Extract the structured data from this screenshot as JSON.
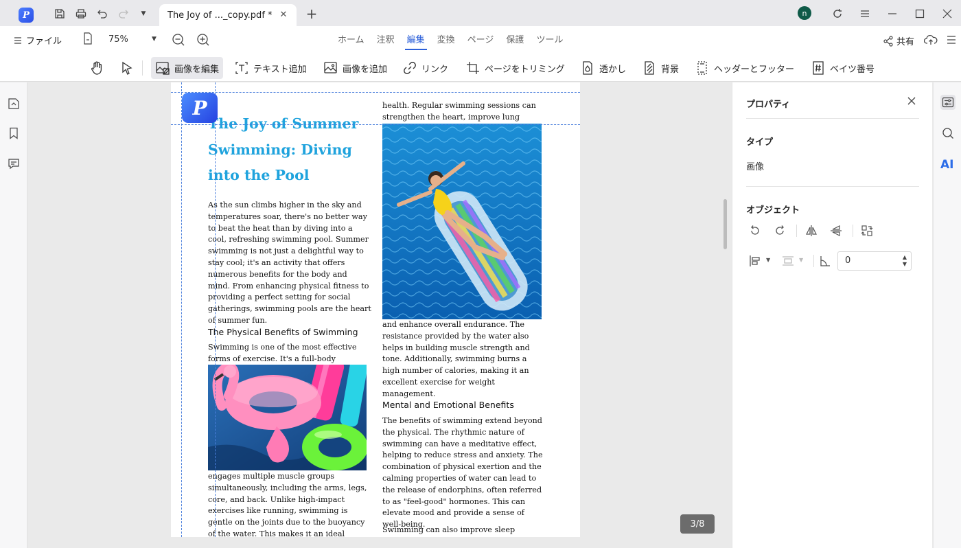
{
  "titlebar": {
    "tab_title": "The Joy of ..._copy.pdf *",
    "avatar_initial": "n"
  },
  "menubar": {
    "file_label": "ファイル",
    "zoom": "75%",
    "tabs": [
      "ホーム",
      "注釈",
      "編集",
      "変換",
      "ページ",
      "保護",
      "ツール"
    ],
    "active_tab": "編集",
    "share_label": "共有"
  },
  "toolbar": {
    "edit_image": "画像を編集",
    "add_text": "テキスト追加",
    "add_image": "画像を追加",
    "link": "リンク",
    "crop_page": "ページをトリミング",
    "watermark": "透かし",
    "background": "背景",
    "header_footer": "ヘッダーとフッター",
    "bates": "ベイツ番号"
  },
  "document": {
    "title": "The Joy of Summer Swimming: Diving into the Pool",
    "intro": "As the sun climbs higher in the sky and temperatures soar, there's no better way to beat the heat than by diving into a cool, refreshing swimming pool. Summer swimming is not just a delightful way to stay cool; it's an activity that offers numerous benefits for the body and mind. From enhancing physical fitness to providing a perfect setting for social gatherings, swimming pools are the heart of summer fun.",
    "section1_heading": "The Physical Benefits of Swimming",
    "section1_a": "Swimming is one of the most effective forms of exercise. It's a full-body workout that",
    "section1_b": "engages multiple muscle groups simultaneously, including the arms, legs, core, and back. Unlike high-impact exercises like running, swimming is gentle on the joints due to the buoyancy of the water. This makes it an ideal exercise for people of all ages and",
    "col2_top": "health. Regular swimming sessions can strengthen the heart, improve lung capacity,",
    "col2_mid": "and enhance overall endurance. The resistance provided by the water also helps in building muscle strength and tone. Additionally, swimming burns a high number of calories, making it an excellent exercise for weight management.",
    "section2_heading": "Mental and Emotional Benefits",
    "section2": "The benefits of swimming extend beyond the physical. The rhythmic nature of swimming can have a meditative effect, helping to reduce stress and anxiety. The combination of physical exertion and the calming properties of water can lead to the release of endorphins, often referred to as \"feel-good\" hormones. This can elevate mood and provide a sense of well-being.",
    "section2_tail": "Swimming can also improve sleep patterns."
  },
  "page_indicator": "3/8",
  "properties": {
    "title": "プロパティ",
    "type_label": "タイプ",
    "type_value": "画像",
    "object_label": "オブジェクト",
    "angle_value": "0"
  },
  "colors": {
    "accent": "#2b5fd9",
    "title_blue": "#1fa3dd",
    "guide": "#4a7fdc"
  }
}
